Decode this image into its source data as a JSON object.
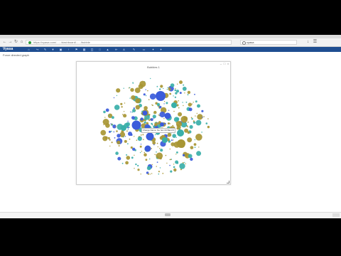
{
  "browser": {
    "back_icon": "back-arrow-icon",
    "forward_icon": "forward-arrow-icon",
    "reload_icon": "reload-icon",
    "home_icon": "home-icon",
    "url": "https://vyasa.com/....../dashboard/....../bubble",
    "search_query": "vyasa",
    "menu_icon": "hamburger-menu-icon"
  },
  "app": {
    "brand": "Vyasa",
    "toolbar_icons": [
      "home-icon",
      "gear-icon",
      "share-icon",
      "pen-icon",
      "filter-icon",
      "save-icon",
      "upload-icon",
      "bookmark-icon",
      "grid-icon",
      "folder-icon",
      "image-icon",
      "chart-icon",
      "text-icon",
      "edit-icon",
      "monitor-icon",
      "pin-icon",
      "star-icon"
    ]
  },
  "breadcrumb": "Force directed graph",
  "panel": {
    "title": "Bubbles 1",
    "tooltip": "Charge Name: Ne hoc 03 Band 0",
    "colors": {
      "blue": "#3b5bdb",
      "teal": "#3aafa9",
      "olive": "#a89634"
    }
  }
}
